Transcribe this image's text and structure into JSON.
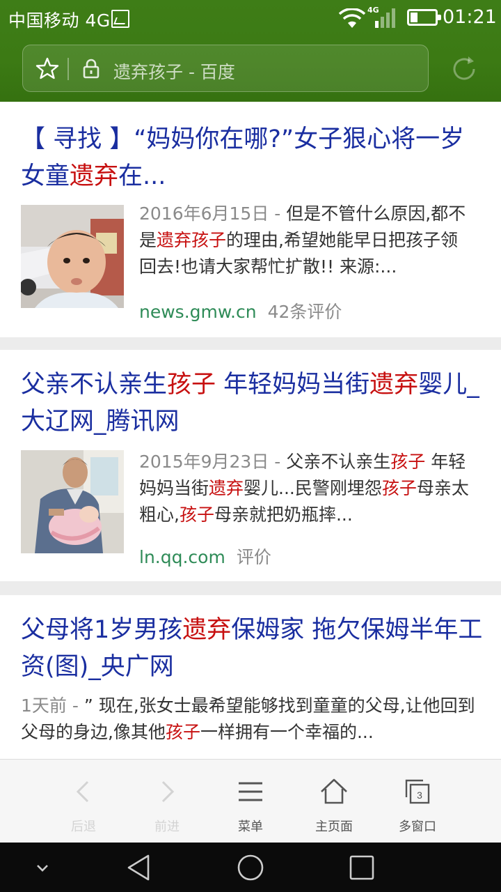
{
  "status_bar": {
    "carrier": "中国移动 4G",
    "network_label": "4G",
    "time": "01:21"
  },
  "address_bar": {
    "url_text": "遗弃孩子 - 百度"
  },
  "results": [
    {
      "title_parts": [
        "【 寻找 】“妈妈你在哪?”女子狠心将一岁女童",
        "遗弃",
        "在..."
      ],
      "date": "2016年6月15日 - ",
      "snippet_parts": [
        "但是不管什么原因,都不是",
        "遗弃孩子",
        "的理由,希望她能早日把孩子领回去!也请大家帮忙扩散!! 来源:..."
      ],
      "source": "news.gmw.cn",
      "reviews": "42条评价"
    },
    {
      "title_parts": [
        "父亲不认亲生",
        "孩子",
        " 年轻妈妈当街",
        "遗弃",
        "婴儿_大辽网_腾讯网"
      ],
      "date": "2015年9月23日 - ",
      "snippet_parts": [
        "父亲不认亲生",
        "孩子",
        " 年轻妈妈当街",
        "遗弃",
        "婴儿...民警刚埋怨",
        "孩子",
        "母亲太粗心,",
        "孩子",
        "母亲就把奶瓶摔..."
      ],
      "source": "ln.qq.com",
      "reviews": "评价"
    },
    {
      "title_parts": [
        "父母将1岁男孩",
        "遗弃",
        "保姆家 拖欠保姆半年工资(图)_央广网"
      ],
      "date": "1天前 - ",
      "snippet_parts": [
        "” 现在,张女士最希望能够找到童童的父母,让他回到父母的身边,像其他",
        "孩子",
        "一样拥有一个幸福的..."
      ]
    }
  ],
  "toolbar": {
    "back": "后退",
    "forward": "前进",
    "menu": "菜单",
    "home": "主页面",
    "windows": "多窗口",
    "window_count": "3"
  },
  "colors": {
    "header_green": "#3c7a14",
    "title_blue": "#1a2ea0",
    "highlight_red": "#c71010",
    "source_green": "#2e8b57"
  }
}
